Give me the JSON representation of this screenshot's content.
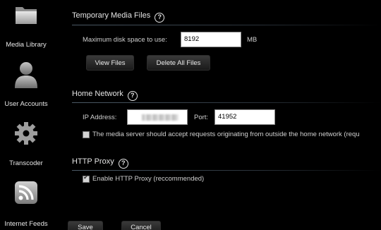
{
  "sidebar": {
    "items": [
      {
        "label": "Media Library",
        "icon": "folder-icon"
      },
      {
        "label": "User Accounts",
        "icon": "user-icon"
      },
      {
        "label": "Transcoder",
        "icon": "gear-icon"
      },
      {
        "label": "Internet Feeds",
        "icon": "rss-icon"
      }
    ]
  },
  "temp_media": {
    "title": "Temporary Media Files",
    "help": "?",
    "max_disk_label": "Maximum disk space to use:",
    "max_disk_value": "8192",
    "unit": "MB",
    "view_files": "View Files",
    "delete_all": "Delete All Files"
  },
  "home_network": {
    "title": "Home Network",
    "help": "?",
    "ip_label": "IP Address:",
    "ip_value": "",
    "port_label": "Port:",
    "port_value": "41952",
    "outside_label": "The media server should accept requests originating from outside the home network (requ",
    "outside_checked": false
  },
  "http_proxy": {
    "title": "HTTP Proxy",
    "help": "?",
    "enable_label": "Enable HTTP Proxy (reccommended)",
    "enable_checked": true
  },
  "footer": {
    "save": "Save",
    "cancel": "Cancel"
  },
  "colors": {
    "background": "#000000",
    "icon_gray": "#9a9a9a",
    "text": "#d8d8d8"
  }
}
